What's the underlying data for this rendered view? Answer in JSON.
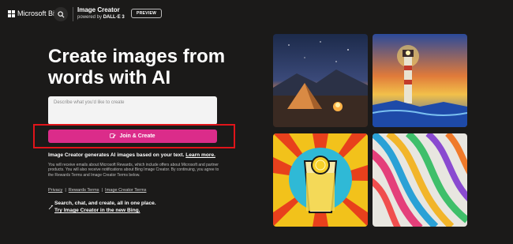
{
  "header": {
    "brand": "Microsoft Bing",
    "app_title": "Image Creator",
    "app_subtitle_prefix": "powered by",
    "app_subtitle_model": "DALL·E 3",
    "preview_badge": "PREVIEW",
    "icons": [
      "windows-logo-icon",
      "search-icon"
    ]
  },
  "hero": {
    "title": "Create images from words with AI"
  },
  "prompt": {
    "placeholder": "Describe what you'd like to create",
    "value": ""
  },
  "join_button": {
    "label": "Join & Create",
    "icon": "create-icon",
    "color": "#db2c8a"
  },
  "highlight_color": "#e0141a",
  "info": {
    "generate_text": "Image Creator generates AI images based on your text.",
    "learn_more": "Learn more.",
    "disclaimer": "You will receive emails about Microsoft Rewards, which include offers about Microsoft and partner products. You will also receive notifications about Bing Image Creator. By continuing, you agree to the Rewards Terms and Image Creator Terms below."
  },
  "links": [
    "Privacy",
    "Rewards Terms",
    "Image Creator Terms"
  ],
  "promo": {
    "line1": "Search, chat, and create, all in one place.",
    "line2": "Try Image Creator in the new Bing."
  },
  "gallery": [
    {
      "name": "camping-tent-night-image"
    },
    {
      "name": "lighthouse-painting-image"
    },
    {
      "name": "pop-art-lemonade-image"
    },
    {
      "name": "colorful-ribbons-image"
    }
  ]
}
